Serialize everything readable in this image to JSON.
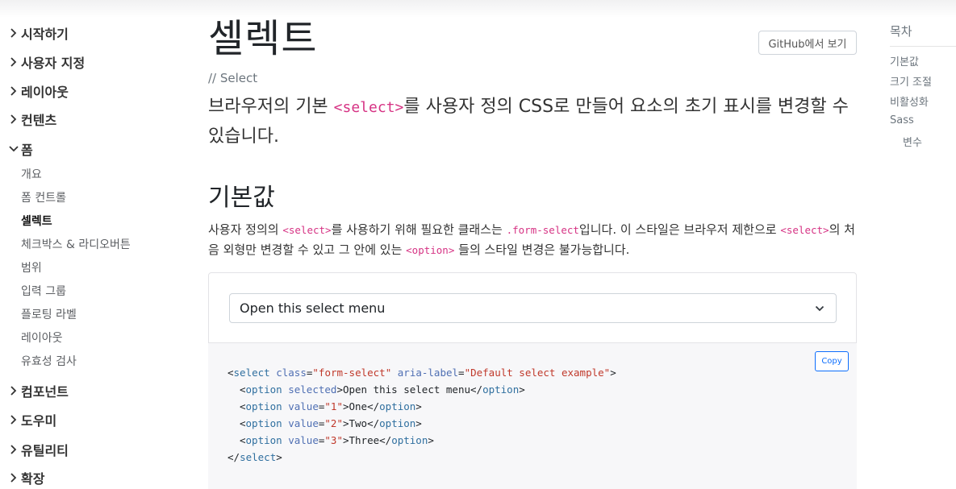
{
  "sidebar": {
    "groups": [
      {
        "label": "시작하기"
      },
      {
        "label": "사용자 지정"
      },
      {
        "label": "레이아웃"
      },
      {
        "label": "컨텐츠"
      },
      {
        "label": "폼"
      },
      {
        "label": "컴포넌트"
      },
      {
        "label": "도우미"
      },
      {
        "label": "유틸리티"
      },
      {
        "label": "확장"
      }
    ],
    "form_items": [
      {
        "label": "개요"
      },
      {
        "label": "폼 컨트롤"
      },
      {
        "label": "셀렉트"
      },
      {
        "label": "체크박스 & 라디오버튼"
      },
      {
        "label": "범위"
      },
      {
        "label": "입력 그룹"
      },
      {
        "label": "플로팅 라벨"
      },
      {
        "label": "레이아웃"
      },
      {
        "label": "유효성 검사"
      }
    ]
  },
  "main": {
    "title": "셀렉트",
    "github_button": "GitHub에서 보기",
    "source_comment": "// Select",
    "lead": {
      "before": "브라우저의 기본 ",
      "code": "<select>",
      "after": "를 사용자 정의 CSS로 만들어 요소의 초기 표시를 변경할 수 있습니다."
    },
    "section_title": "기본값",
    "paragraph": {
      "p1": "사용자 정의의 ",
      "c1": "<select>",
      "p2": "를 사용하기 위해 필요한 클래스는 ",
      "c2": ".form-select",
      "p3": "입니다. 이 스타일은 브라우저 제한으로 ",
      "c3": "<select>",
      "p4": "의 처음 외형만 변경할 수 있고 그 안에 있는 ",
      "c4": "<option>",
      "p5": " 들의 스타일 변경은 불가능합니다."
    },
    "example_select": {
      "value": "Open this select menu"
    },
    "copy_button": "Copy",
    "code": {
      "l1_tag": "select",
      "l1_attr1": "class",
      "l1_val1": "\"form-select\"",
      "l1_attr2": "aria-label",
      "l1_val2": "\"Default select example\"",
      "l2_tag": "option",
      "l2_attr": "selected",
      "l2_text": "Open this select menu",
      "l3_tag": "option",
      "l3_attr": "value",
      "l3_val": "\"1\"",
      "l3_text": "One",
      "l4_tag": "option",
      "l4_attr": "value",
      "l4_val": "\"2\"",
      "l4_text": "Two",
      "l5_tag": "option",
      "l5_attr": "value",
      "l5_val": "\"3\"",
      "l5_text": "Three",
      "l6_tag": "select"
    }
  },
  "toc": {
    "title": "목차",
    "items": [
      {
        "label": "기본값"
      },
      {
        "label": "크기 조절"
      },
      {
        "label": "비활성화"
      },
      {
        "label": "Sass"
      },
      {
        "label": "변수"
      }
    ]
  },
  "colors": {
    "accent": "#0d6efd",
    "code_pink": "#d63384"
  }
}
